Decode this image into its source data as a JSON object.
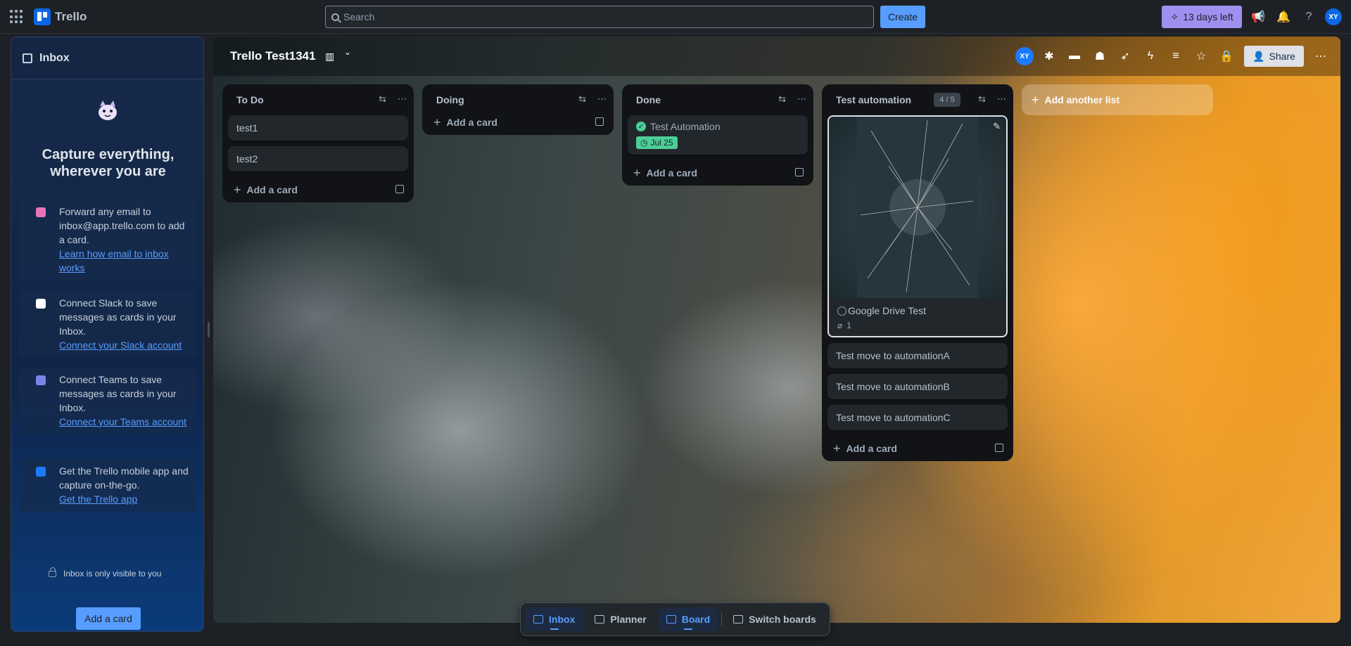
{
  "topbar": {
    "app_name": "Trello",
    "search_placeholder": "Search",
    "create_label": "Create",
    "trial_label": "13 days left",
    "avatar_initials": "XY"
  },
  "inbox": {
    "title": "Inbox",
    "headline": "Capture everything, wherever you are",
    "tips": [
      {
        "text": "Forward any email to inbox@app.trello.com to add a card.",
        "link": "Learn how email to inbox works",
        "icon": "email-icon",
        "color": "#e774bb"
      },
      {
        "text": "Connect Slack to save messages as cards in your Inbox.",
        "link": "Connect your Slack account",
        "icon": "slack-icon",
        "color": "#ffffff"
      },
      {
        "text": "Connect Teams to save messages as cards in your Inbox.",
        "link": "Connect your Teams account",
        "icon": "teams-icon",
        "color": "#7b83eb"
      },
      {
        "text": "Get the Trello mobile app and capture on-the-go.",
        "link": "Get the Trello app",
        "icon": "mobile-app-icon",
        "color": "#1d7afc"
      }
    ],
    "private_note": "Inbox is only visible to you",
    "add_card_label": "Add a card"
  },
  "board": {
    "title": "Trello Test1341",
    "member_initials": "XY",
    "share_label": "Share",
    "add_list_label": "Add another list",
    "lists": [
      {
        "title": "To Do",
        "cards": [
          "test1",
          "test2"
        ],
        "add_label": "Add a card"
      },
      {
        "title": "Doing",
        "cards": [],
        "add_label": "Add a card"
      },
      {
        "title": "Done",
        "cards": [
          {
            "title": "Test Automation",
            "due": "Jul 25",
            "complete": true
          }
        ],
        "add_label": "Add a card"
      },
      {
        "title": "Test automation",
        "count": "4 / 5",
        "cover_card": {
          "title": "Google Drive Test",
          "attachments": "1"
        },
        "cards": [
          "Test move to automationA",
          "Test move to automationB",
          "Test move to automationC"
        ],
        "add_label": "Add a card"
      }
    ]
  },
  "switcher": {
    "items": [
      {
        "label": "Inbox",
        "active": true
      },
      {
        "label": "Planner",
        "active": false
      },
      {
        "label": "Board",
        "active": true
      },
      {
        "label": "Switch boards",
        "active": false
      }
    ]
  },
  "colors": {
    "accent": "#579dff",
    "trial": "#9f8fef",
    "done_badge": "#4bce97"
  }
}
